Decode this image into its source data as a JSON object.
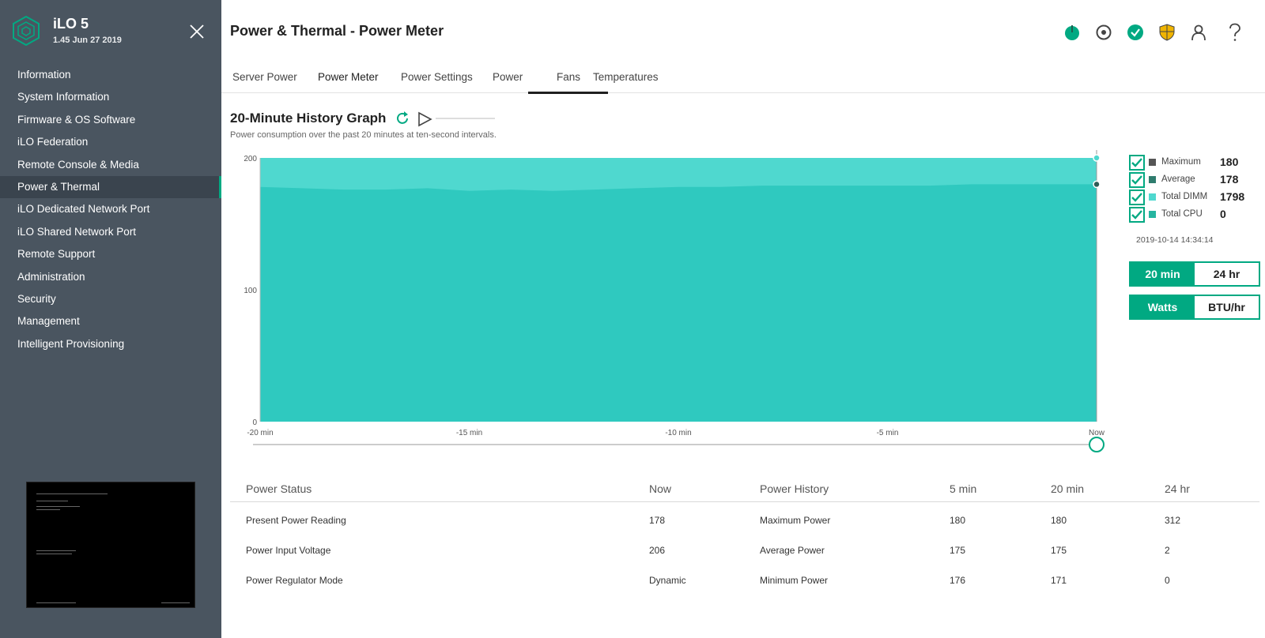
{
  "app": {
    "name": "iLO 5",
    "version": "1.45 Jun 27 2019"
  },
  "sidebar": {
    "items": [
      {
        "label": "Information"
      },
      {
        "label": "System Information"
      },
      {
        "label": "Firmware & OS Software"
      },
      {
        "label": "iLO Federation"
      },
      {
        "label": "Remote Console & Media"
      },
      {
        "label": "Power & Thermal",
        "active": true
      },
      {
        "label": "iLO Dedicated Network Port"
      },
      {
        "label": "iLO Shared Network Port"
      },
      {
        "label": "Remote Support"
      },
      {
        "label": "Administration"
      },
      {
        "label": "Security"
      },
      {
        "label": "Management"
      },
      {
        "label": "Intelligent Provisioning"
      }
    ]
  },
  "header": {
    "title": "Power & Thermal - Power Meter",
    "icons": [
      "power-icon",
      "locate-icon",
      "health-ok-icon",
      "security-shield-icon",
      "user-icon",
      "help-icon"
    ]
  },
  "tabs": [
    {
      "label": "Server Power"
    },
    {
      "label": "Power Meter",
      "active": true
    },
    {
      "label": "Power Settings"
    },
    {
      "label": "Power"
    },
    {
      "label": "Fans"
    },
    {
      "label": "Temperatures"
    }
  ],
  "graph": {
    "title": "20-Minute History Graph",
    "subtitle": "Power consumption over the past 20 minutes at ten-second intervals."
  },
  "chart_data": {
    "type": "area",
    "x_ticks": [
      "-20 min",
      "-15 min",
      "-10 min",
      "-5 min",
      "Now"
    ],
    "y_ticks": [
      "200",
      "100",
      "0"
    ],
    "ylim": [
      0,
      200
    ],
    "series": [
      {
        "name": "Maximum",
        "color": "#4fd8cf",
        "values": [
          200,
          200,
          200,
          200,
          200
        ]
      },
      {
        "name": "Average",
        "color": "#2fc9bf",
        "values": [
          178,
          177,
          176,
          176,
          177,
          175,
          176,
          175,
          176,
          177,
          178,
          178,
          179,
          179,
          179,
          179,
          179,
          180,
          180,
          180,
          180
        ]
      }
    ]
  },
  "legend": {
    "items": [
      {
        "label": "Maximum",
        "value": "180",
        "color": "#555555"
      },
      {
        "label": "Average",
        "value": "178",
        "color": "#2f7c6e"
      },
      {
        "label": "Total DIMM",
        "value": "1798",
        "color": "#4fd8cf"
      },
      {
        "label": "Total CPU",
        "value": "0",
        "color": "#26b5a0"
      }
    ],
    "timestamp": "2019-10-14 14:34:14"
  },
  "toggles": {
    "range": {
      "on": "20 min",
      "off": "24 hr"
    },
    "unit": {
      "on": "Watts",
      "off": "BTU/hr"
    }
  },
  "power_table": {
    "headers": [
      "Power Status",
      "Now",
      "Power History",
      "5 min",
      "20 min",
      "24 hr"
    ],
    "rows": [
      [
        "Present Power Reading",
        "178",
        "Maximum Power",
        "180",
        "180",
        "312"
      ],
      [
        "Power Input Voltage",
        "206",
        "Average Power",
        "175",
        "175",
        "2"
      ],
      [
        "Power Regulator Mode",
        "Dynamic",
        "Minimum Power",
        "176",
        "171",
        "0"
      ]
    ]
  },
  "colors": {
    "accent": "#01a982",
    "sidebar": "#4a5560"
  }
}
